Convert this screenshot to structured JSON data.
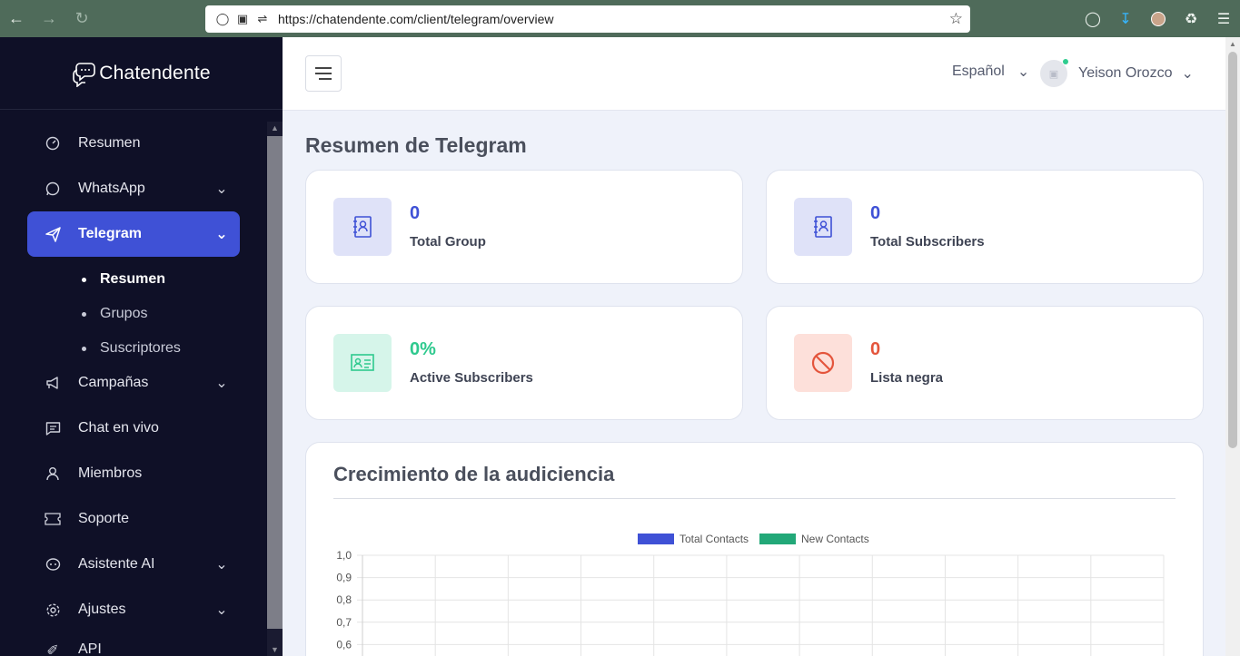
{
  "browser": {
    "url": "https://chatendente.com/client/telegram/overview"
  },
  "brand": {
    "name": "Chatendente"
  },
  "sidebar": {
    "items": [
      {
        "label": "Resumen",
        "icon": "speedometer-icon",
        "expandable": false
      },
      {
        "label": "WhatsApp",
        "icon": "whatsapp-icon",
        "expandable": true
      },
      {
        "label": "Telegram",
        "icon": "paper-plane-icon",
        "expandable": true,
        "active": true
      },
      {
        "label": "Campañas",
        "icon": "megaphone-icon",
        "expandable": true
      },
      {
        "label": "Chat en vivo",
        "icon": "chat-icon",
        "expandable": false
      },
      {
        "label": "Miembros",
        "icon": "user-icon",
        "expandable": false
      },
      {
        "label": "Soporte",
        "icon": "ticket-icon",
        "expandable": false
      },
      {
        "label": "Asistente AI",
        "icon": "bot-icon",
        "expandable": true
      },
      {
        "label": "Ajustes",
        "icon": "gear-icon",
        "expandable": true
      },
      {
        "label": "API",
        "icon": "code-icon",
        "expandable": false
      }
    ],
    "telegram_sub": [
      {
        "label": "Resumen",
        "current": true
      },
      {
        "label": "Grupos",
        "current": false
      },
      {
        "label": "Suscriptores",
        "current": false
      }
    ]
  },
  "header": {
    "language": "Español",
    "user_name": "Yeison Orozco"
  },
  "page": {
    "title": "Resumen de Telegram",
    "stats": [
      {
        "value": "0",
        "label": "Total Group",
        "color": "#3f51d6",
        "bg": "#dfe2f8",
        "icon": "contact-book-icon"
      },
      {
        "value": "0",
        "label": "Total Subscribers",
        "color": "#3f51d6",
        "bg": "#dfe2f8",
        "icon": "contact-book-icon"
      },
      {
        "value": "0%",
        "label": "Active Subscribers",
        "color": "#2ec98e",
        "bg": "#d6f5ea",
        "icon": "id-card-icon"
      },
      {
        "value": "0",
        "label": "Lista negra",
        "color": "#e4553c",
        "bg": "#fde0da",
        "icon": "block-icon"
      }
    ]
  },
  "chart_data": {
    "type": "line",
    "title": "Crecimiento de la audiciencia",
    "series": [
      {
        "name": "Total Contacts",
        "color": "#3f51d6",
        "values": []
      },
      {
        "name": "New Contacts",
        "color": "#22a878",
        "values": []
      }
    ],
    "yticks": [
      "1,0",
      "0,9",
      "0,8",
      "0,7",
      "0,6"
    ],
    "ylim": [
      0,
      1
    ],
    "grid": true,
    "legend": "top"
  }
}
